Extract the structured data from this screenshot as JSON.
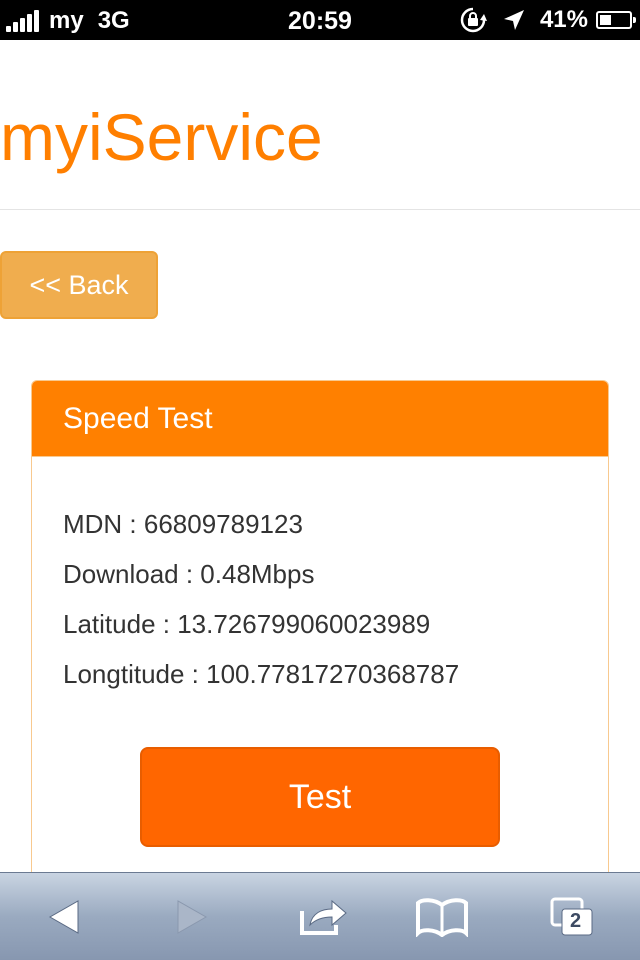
{
  "status_bar": {
    "carrier": "my",
    "network": "3G",
    "time": "20:59",
    "battery_percent": "41%",
    "battery_level": 0.41,
    "icons": [
      "signal-bars-icon",
      "rotation-lock-icon",
      "location-arrow-icon",
      "battery-icon"
    ]
  },
  "header": {
    "brand": "myiService",
    "brand_color": "#ff7f00"
  },
  "back_button": {
    "label": "<< Back"
  },
  "panel": {
    "title": "Speed Test",
    "heading_color": "#ff8000",
    "lines": [
      "MDN : 66809789123",
      "Download : 0.48Mbps",
      "Latitude : 13.726799060023989",
      "Longtitude : 100.77817270368787"
    ],
    "test_button": {
      "label": "Test",
      "color": "#ff6600"
    }
  },
  "toolbar": {
    "icons": [
      "back-arrow-icon",
      "forward-arrow-icon",
      "share-icon",
      "bookmarks-icon",
      "tabs-icon"
    ],
    "tab_count": "2"
  }
}
